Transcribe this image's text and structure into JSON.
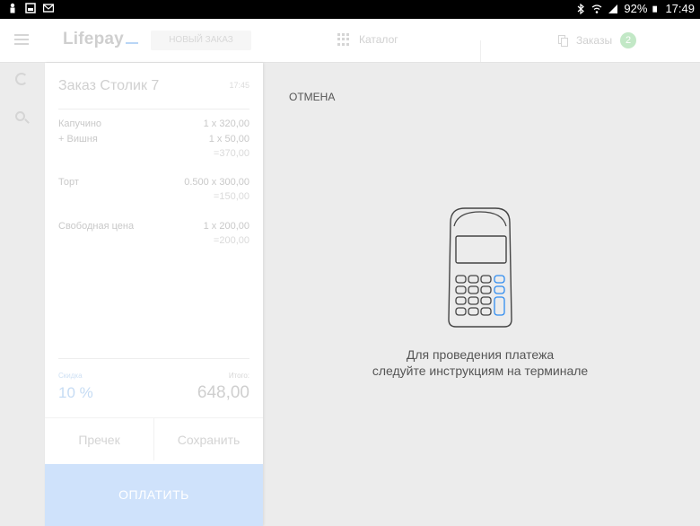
{
  "status_bar": {
    "battery": "92%",
    "time": "17:49",
    "icons": [
      "person-icon",
      "image-icon",
      "mail-icon",
      "bluetooth-icon",
      "wifi-icon",
      "signal-icon",
      "battery-icon"
    ]
  },
  "app_bar": {
    "logo": "Lifepay",
    "new_order": "НОВЫЙ ЗАКАЗ",
    "tab_catalog": "Каталог",
    "tab_orders": "Заказы",
    "orders_count": "2",
    "accent_color": "#2f8cf0",
    "badge_color": "#4caf50"
  },
  "order": {
    "title": "Заказ Столик 7",
    "time": "17:45",
    "items": [
      {
        "name": "Капучино",
        "qty": "1 x 320,00"
      },
      {
        "name": "+ Вишня",
        "qty": "1 x 50,00",
        "sum": "=370,00"
      },
      {
        "name": "Торт",
        "qty": "0.500 x 300,00",
        "sum": "=150,00"
      },
      {
        "name": "Свободная цена",
        "qty": "1 x 200,00",
        "sum": "=200,00"
      }
    ],
    "discount_label": "Скидка",
    "discount_value": "10 %",
    "total_label": "Итого:",
    "total_value": "648,00",
    "receipt_button": "Пречек",
    "save_button": "Сохранить",
    "pay_button": "ОПЛАТИТЬ"
  },
  "payment": {
    "cancel": "ОТМЕНА",
    "message_line1": "Для проведения платежа",
    "message_line2": "следуйте инструкциям на терминале",
    "terminal_key_color": "#2f8cf0"
  }
}
